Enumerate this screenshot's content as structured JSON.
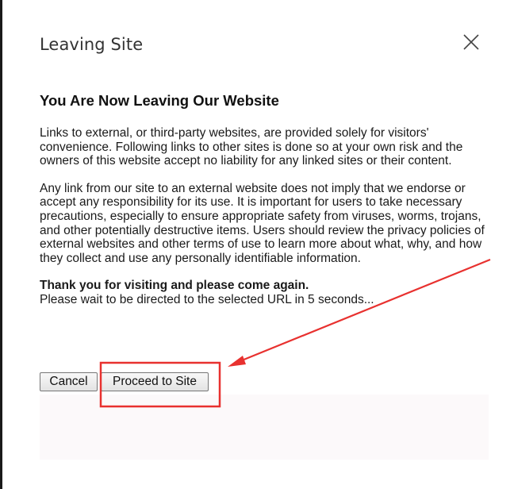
{
  "modal": {
    "title": "Leaving Site",
    "close_icon": "close-icon"
  },
  "content": {
    "heading": "You Are Now Leaving Our Website",
    "paragraph1": "Links to external, or third-party websites, are provided solely for visitors' convenience. Following links to other sites is done so at your own risk and the owners of this website accept no liability for any linked sites or their content.",
    "paragraph2": "Any link from our site to an external website does not imply that we endorse or accept any responsibility for its use. It is important for users to take necessary precautions, especially to ensure appropriate safety from viruses, worms, trojans, and other potentially destructive items. Users should review the privacy policies of external websites and other terms of use to learn more about what, why, and how they collect and use any personally identifiable information.",
    "thanks": "Thank you for visiting and please come again.",
    "redirect_notice": "Please wait to be directed to the selected URL in 5 seconds..."
  },
  "buttons": {
    "cancel_label": "Cancel",
    "proceed_label": "Proceed to Site"
  },
  "annotation": {
    "color": "#e8312f"
  }
}
